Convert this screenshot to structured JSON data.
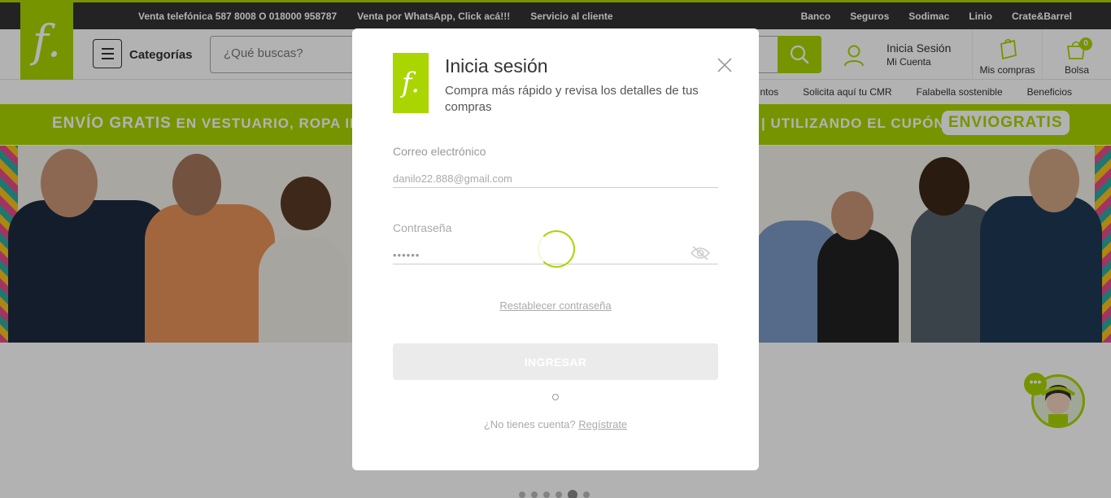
{
  "topbar": {
    "left_links": [
      "Venta telefónica 587 8008 O 018000 958787",
      "Venta por WhatsApp, Click acá!!!",
      "Servicio al cliente"
    ],
    "right_links": [
      "Banco",
      "Seguros",
      "Sodimac",
      "Linio",
      "Crate&Barrel"
    ]
  },
  "brand": {
    "logo_letter": "f.",
    "accent_color": "#aad500"
  },
  "header": {
    "categories_label": "Categorías",
    "search_placeholder": "¿Qué buscas?",
    "account_line1": "Inicia Sesión",
    "account_line2": "Mi Cuenta",
    "my_purchases_label": "Mis compras",
    "bag_label": "Bolsa",
    "bag_count": "0"
  },
  "subnav": {
    "links": [
      "ntos",
      "Solicita aquí tu CMR",
      "Falabella sostenible",
      "Beneficios"
    ]
  },
  "promo": {
    "part1_big": "ENVÍO GRATIS",
    "part1_rest": "EN VESTUARIO, ROPA INT",
    "part2": "| UTILIZANDO EL CUPÓN",
    "coupon": "ENVIOGRATIS"
  },
  "modal": {
    "logo_letter": "f.",
    "title": "Inicia sesión",
    "subtitle": "Compra más rápido y revisa los detalles de tus compras",
    "email_label": "Correo electrónico",
    "email_value": "danilo22.888@gmail.com",
    "password_label": "Contraseña",
    "password_value": "••••••",
    "reset_link": "Restablecer contraseña",
    "submit_label": "INGRESAR",
    "no_account_text": "¿No tienes cuenta?",
    "register_link": "Regístrate"
  },
  "carousel": {
    "dot_count": 6,
    "active_index": 4
  }
}
